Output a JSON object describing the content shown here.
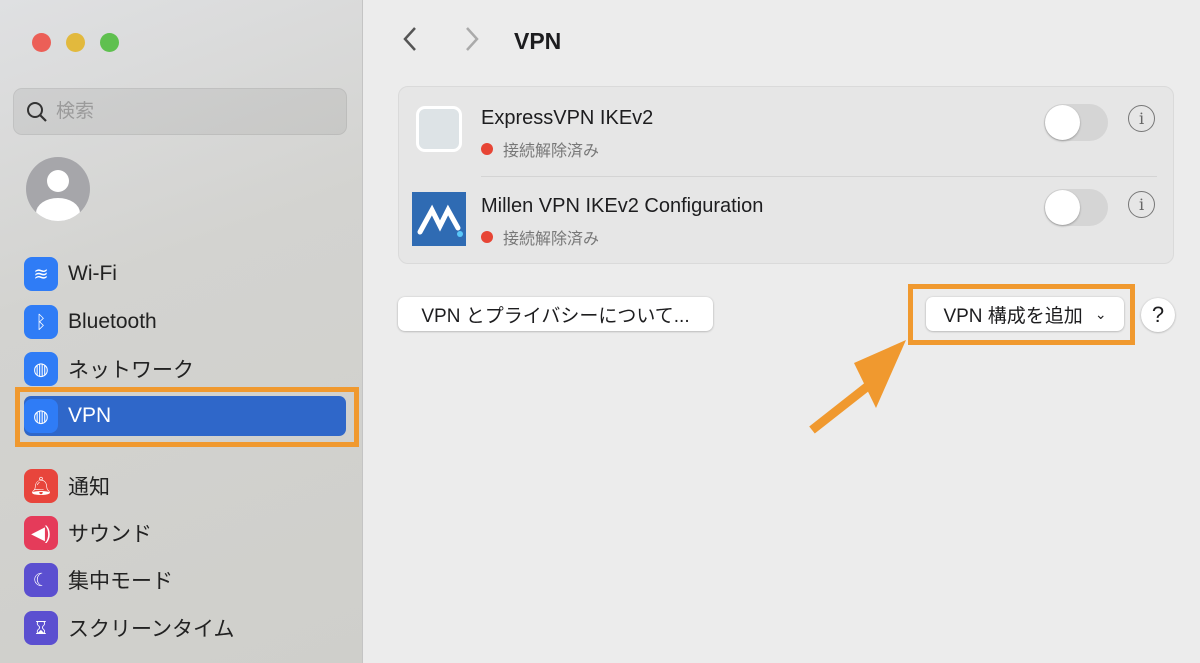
{
  "sidebar": {
    "search_placeholder": "検索",
    "items": [
      {
        "label": "Wi-Fi",
        "color": "#2f7cf6"
      },
      {
        "label": "Bluetooth",
        "color": "#2f7cf6"
      },
      {
        "label": "ネットワーク",
        "color": "#2f7cf6"
      },
      {
        "label": "VPN",
        "color": "#2f7cf6"
      },
      {
        "label": "通知",
        "color": "#e8453c"
      },
      {
        "label": "サウンド",
        "color": "#e53b5a"
      },
      {
        "label": "集中モード",
        "color": "#5b4fd0"
      },
      {
        "label": "スクリーンタイム",
        "color": "#5b4fd0"
      }
    ],
    "selected": "VPN"
  },
  "header": {
    "title": "VPN"
  },
  "vpns": [
    {
      "name": "ExpressVPN IKEv2",
      "status": "接続解除済み",
      "enabled": false
    },
    {
      "name": "Millen VPN IKEv2 Configuration",
      "status": "接続解除済み",
      "enabled": false
    }
  ],
  "buttons": {
    "about": "VPN とプライバシーについて...",
    "add": "VPN 構成を追加",
    "help": "?"
  },
  "colors": {
    "highlight": "#f0992f",
    "selection": "#2f67c9",
    "disconnected": "#e74535"
  }
}
